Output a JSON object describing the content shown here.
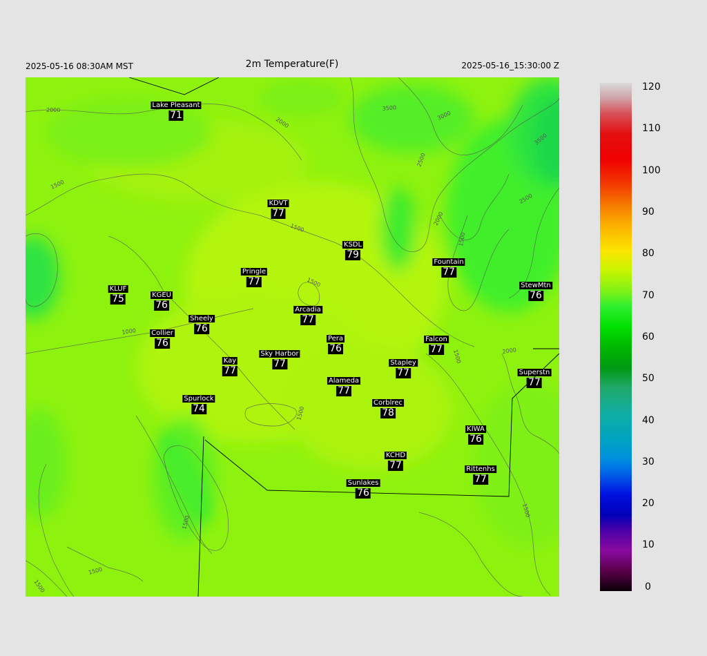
{
  "header": {
    "left": "2025-05-16 08:30AM MST",
    "title": "2m Temperature(F)",
    "right": "2025-05-16_15:30:00 Z"
  },
  "stations": [
    {
      "name": "Lake Pleasant",
      "value": "71"
    },
    {
      "name": "KDVT",
      "value": "77"
    },
    {
      "name": "KSDL",
      "value": "79"
    },
    {
      "name": "Pringle",
      "value": "77"
    },
    {
      "name": "Fountain",
      "value": "77"
    },
    {
      "name": "KLUF",
      "value": "75"
    },
    {
      "name": "KGEU",
      "value": "76"
    },
    {
      "name": "StewMtn",
      "value": "76"
    },
    {
      "name": "Arcadia",
      "value": "77"
    },
    {
      "name": "Sheely",
      "value": "76"
    },
    {
      "name": "Collier",
      "value": "76"
    },
    {
      "name": "Pera",
      "value": "76"
    },
    {
      "name": "Falcon",
      "value": "77"
    },
    {
      "name": "Sky Harbor",
      "value": "77"
    },
    {
      "name": "Kay",
      "value": "77"
    },
    {
      "name": "Stapley",
      "value": "77"
    },
    {
      "name": "Superstn",
      "value": "77"
    },
    {
      "name": "Alameda",
      "value": "77"
    },
    {
      "name": "Spurlock",
      "value": "74"
    },
    {
      "name": "Corblrec",
      "value": "78"
    },
    {
      "name": "KIWA",
      "value": "76"
    },
    {
      "name": "KCHD",
      "value": "77"
    },
    {
      "name": "Rittenhs",
      "value": "77"
    },
    {
      "name": "Sunlakes",
      "value": "76"
    }
  ],
  "contour_labels": [
    "2000",
    "2000",
    "1500",
    "1500",
    "3500",
    "3000",
    "2500",
    "2000",
    "1500",
    "3500",
    "2500",
    "1500",
    "1000",
    "1500",
    "2000",
    "1500",
    "1500",
    "1500",
    "1500",
    "1500"
  ],
  "colorbar": {
    "ticks": [
      "120",
      "110",
      "100",
      "90",
      "80",
      "70",
      "60",
      "50",
      "40",
      "30",
      "20",
      "10",
      "0"
    ],
    "min": 0,
    "max": 120
  }
}
